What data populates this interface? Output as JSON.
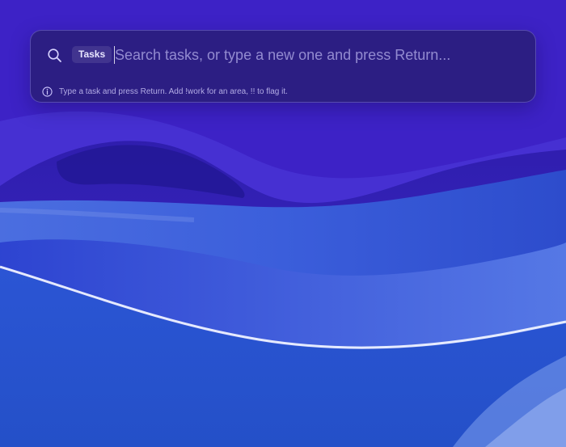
{
  "palette": {
    "scope_chip_label": "Tasks",
    "search_placeholder": "Search tasks, or type a new one and press Return...",
    "search_value": "",
    "hint": "Type a task and press Return. Add !work for an area, !! to flag it."
  },
  "icons": {
    "search": "search-icon",
    "info": "info-icon"
  },
  "colors": {
    "wallpaper_top": "#3a1fc0",
    "wallpaper_bottom": "#2f5fd8",
    "palette_bg": "#2a1e78"
  }
}
